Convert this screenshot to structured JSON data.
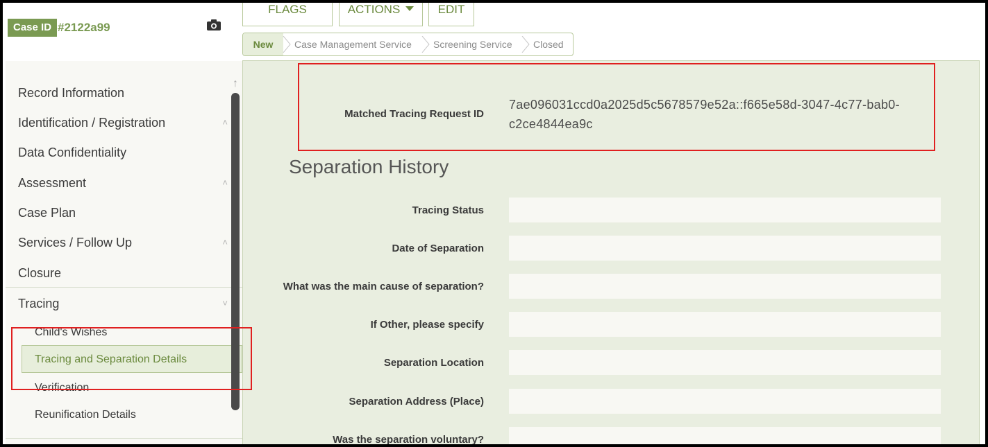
{
  "case": {
    "id_label": "Case ID",
    "id_value": "#2122a99"
  },
  "toolbar": {
    "flags_label": "FLAGS",
    "actions_label": "ACTIONS",
    "edit_label": "EDIT"
  },
  "workflow": {
    "steps": [
      "New",
      "Case Management Service",
      "Screening Service",
      "Closed"
    ]
  },
  "sidebar": {
    "items": [
      {
        "label": "Record Information"
      },
      {
        "label": "Identification / Registration",
        "chevron": "^"
      },
      {
        "label": "Data Confidentiality"
      },
      {
        "label": "Assessment",
        "chevron": "^"
      },
      {
        "label": "Case Plan"
      },
      {
        "label": "Services / Follow Up",
        "chevron": "^"
      },
      {
        "label": "Closure"
      },
      {
        "label": "Tracing",
        "chevron": "v"
      }
    ],
    "tracing_subitems": [
      {
        "label": "Child's Wishes"
      },
      {
        "label": "Tracing and Separation Details",
        "active": true
      },
      {
        "label": "Verification"
      },
      {
        "label": "Reunification Details"
      }
    ]
  },
  "form": {
    "matched_label": "Matched Tracing Request ID",
    "matched_value": "7ae096031ccd0a2025d5c5678579e52a::f665e58d-3047-4c77-bab0-c2ce4844ea9c",
    "section_title": "Separation History",
    "fields": [
      {
        "label": "Tracing Status",
        "value": ""
      },
      {
        "label": "Date of Separation",
        "value": ""
      },
      {
        "label": "What was the main cause of separation?",
        "value": ""
      },
      {
        "label": "If Other, please specify",
        "value": ""
      },
      {
        "label": "Separation Location",
        "value": ""
      },
      {
        "label": "Separation Address (Place)",
        "value": ""
      },
      {
        "label": "Was the separation voluntary?",
        "value": ""
      }
    ]
  },
  "colors": {
    "accent": "#7a9a52",
    "panel_bg": "#e9eee0",
    "highlight": "#e02020"
  }
}
